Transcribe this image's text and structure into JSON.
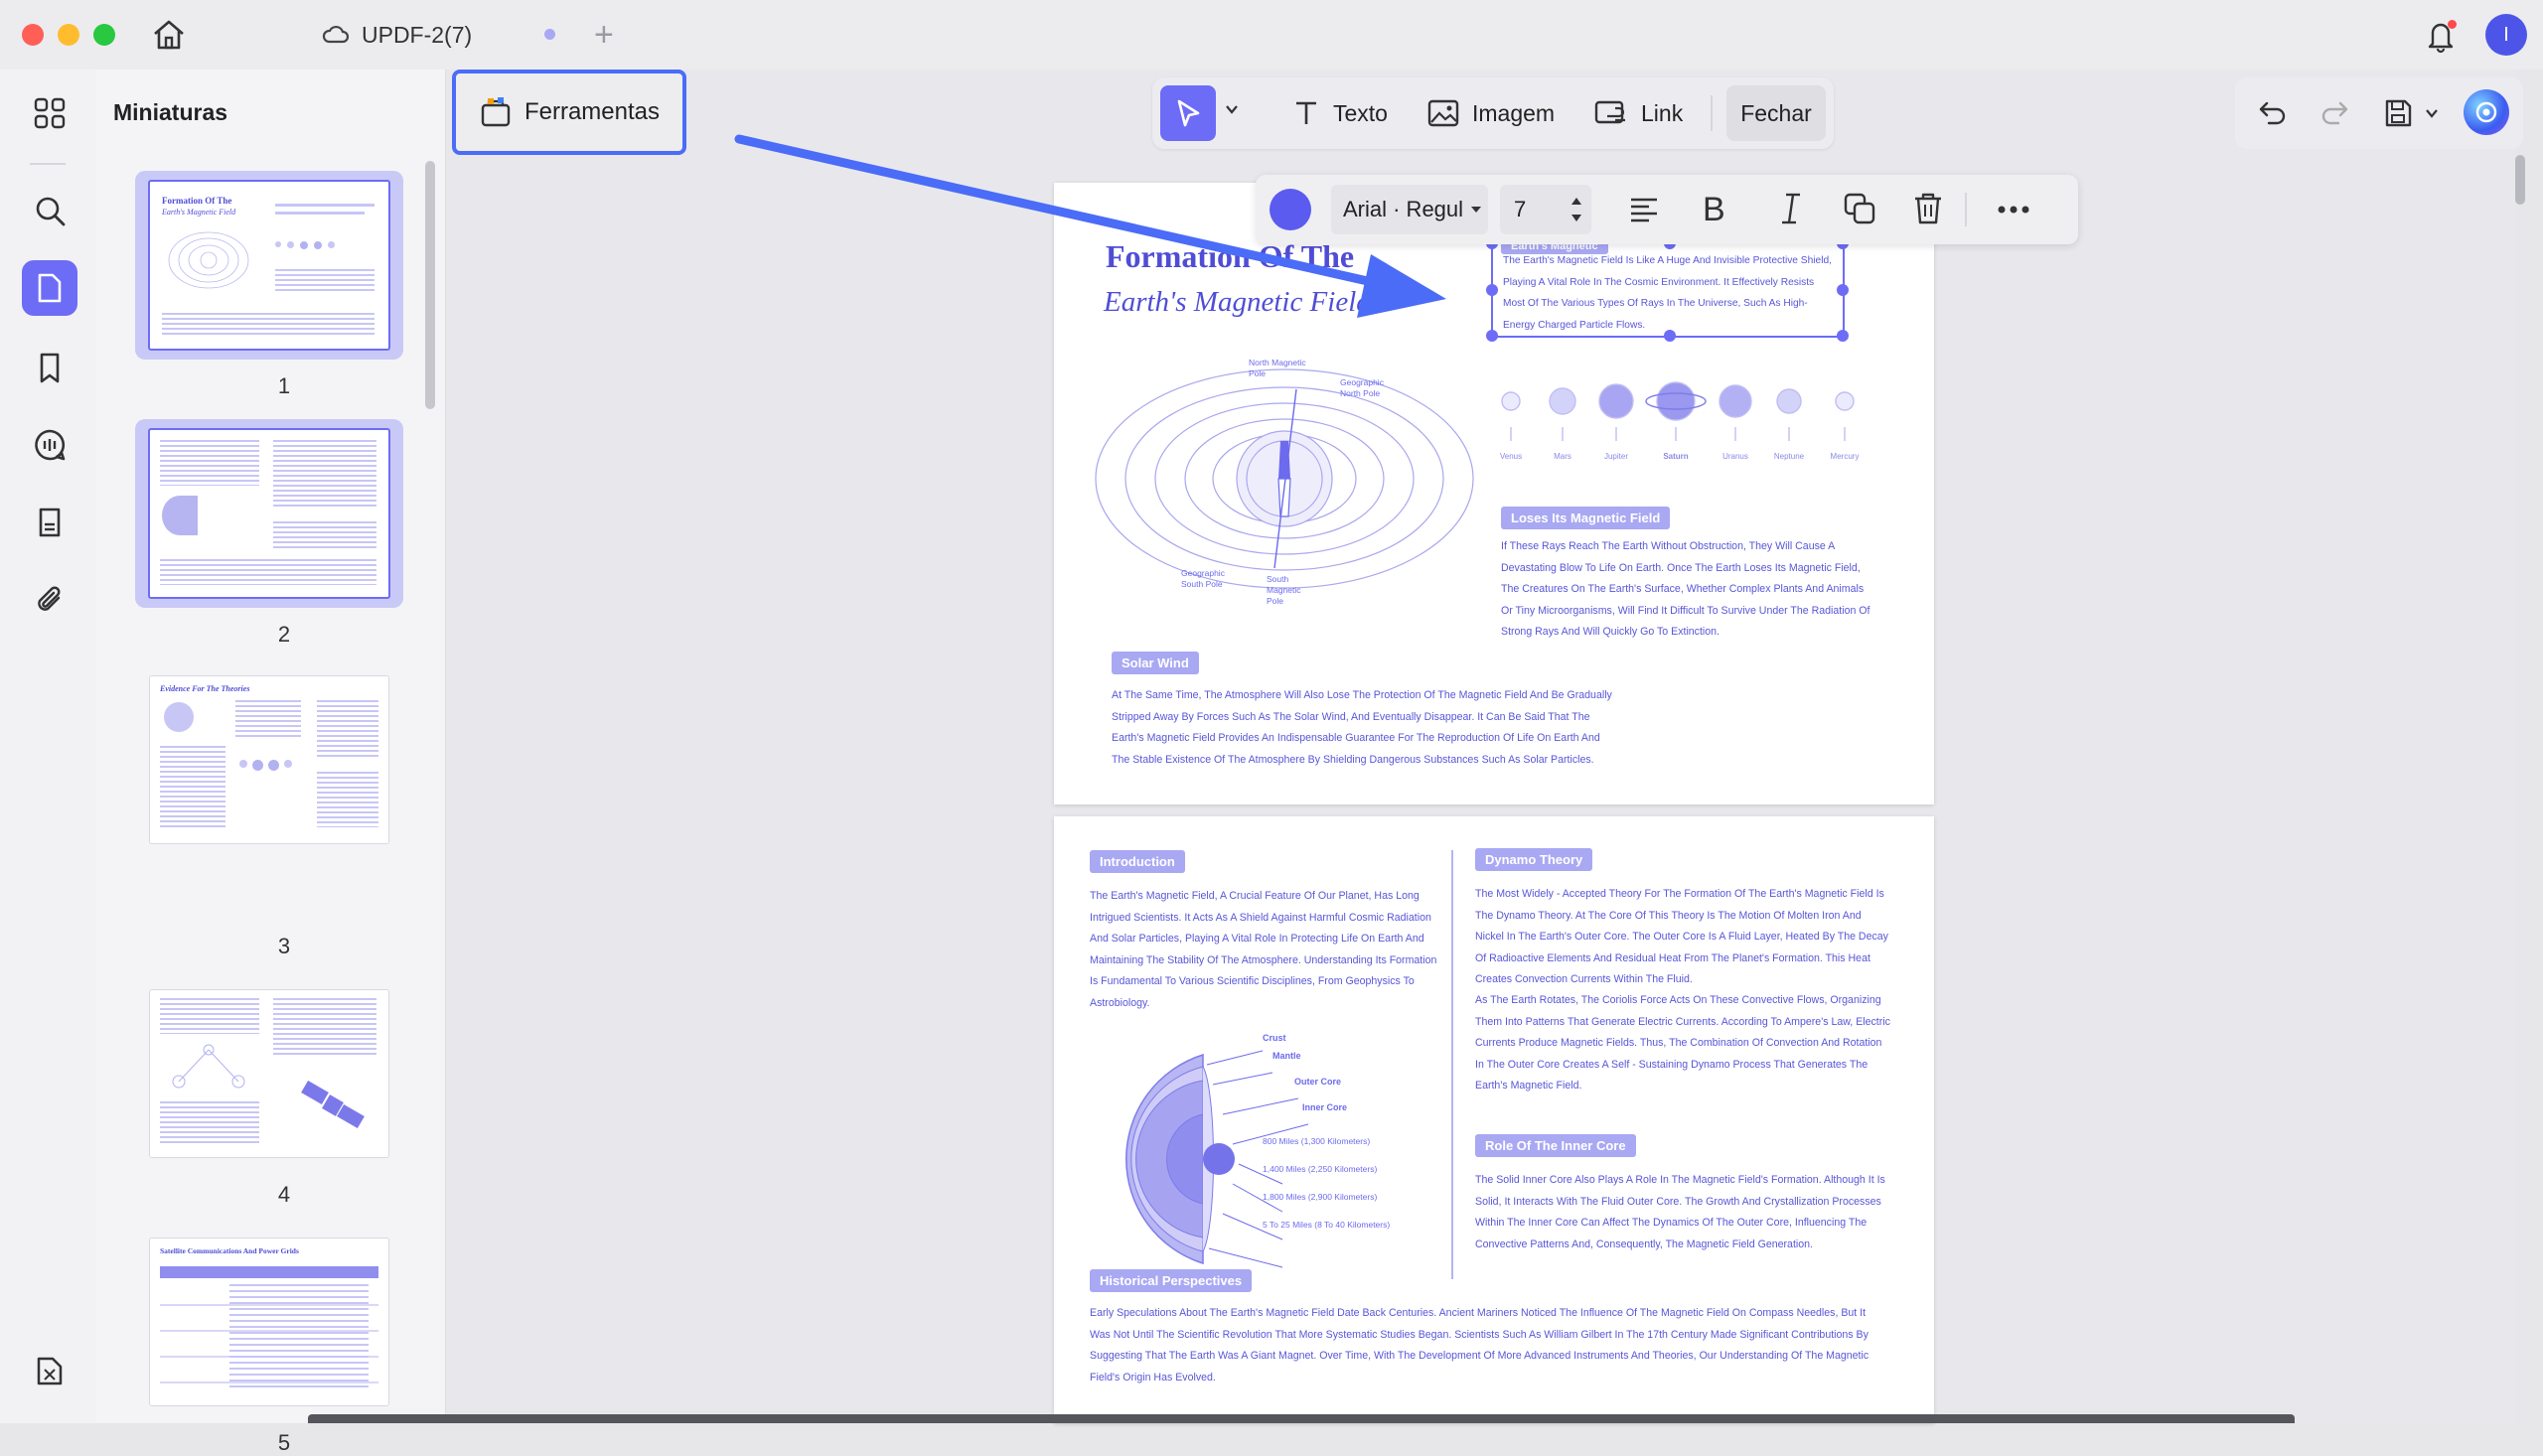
{
  "window": {
    "tab_title": "UPDF-2(7)",
    "user_initial": "I"
  },
  "sidebar": {
    "panel_title": "Miniaturas"
  },
  "thumbnails": [
    {
      "number": "1",
      "title": "Formation Of The",
      "subtitle": "Earth's Magnetic Field"
    },
    {
      "number": "2"
    },
    {
      "number": "3",
      "title": "Evidence For The Theories"
    },
    {
      "number": "4"
    },
    {
      "number": "5",
      "title": "Satellite Communications And Power Grids"
    }
  ],
  "toolbar": {
    "tools_label": "Ferramentas",
    "text_label": "Texto",
    "image_label": "Imagem",
    "link_label": "Link",
    "close_label": "Fechar"
  },
  "format_bar": {
    "color": "#5b5bf0",
    "font": "Arial · Regul",
    "size": "7"
  },
  "page1": {
    "title_line1": "Formation Of The",
    "title_line2": "Earth's Magnetic Field",
    "selected_heading": "Earth's Magnetic",
    "selected_text": "The Earth's Magnetic Field Is Like A Huge And Invisible Protective Shield, Playing A Vital Role In The Cosmic Environment. It Effectively Resists Most Of The Various Types Of Rays In The Universe, Such As High-Energy Charged Particle Flows.",
    "diagram_labels": {
      "north_magnetic": "North Magnetic Pole",
      "geographic_north": "Geographic North Pole",
      "geographic_south": "Geographic South Pole",
      "south_magnetic": "South Magnetic Pole"
    },
    "planets": [
      "Venus",
      "Mars",
      "Jupiter",
      "Saturn",
      "Uranus",
      "Neptune",
      "Mercury"
    ],
    "loses_heading": "Loses Its Magnetic Field",
    "loses_text": "If These Rays Reach The Earth Without Obstruction, They Will Cause A Devastating Blow To Life On Earth. Once The Earth Loses Its Magnetic Field, The Creatures On The Earth's Surface, Whether Complex Plants And Animals Or Tiny Microorganisms, Will Find It Difficult To Survive Under The Radiation Of Strong Rays And Will Quickly Go To Extinction.",
    "solar_heading": "Solar Wind",
    "solar_text": "At The Same Time, The Atmosphere Will Also Lose The Protection Of The Magnetic Field And Be Gradually Stripped Away By Forces Such As The Solar Wind, And Eventually Disappear. It Can Be Said That The Earth's Magnetic Field Provides An Indispensable Guarantee For The Reproduction Of Life On Earth And The Stable Existence Of The Atmosphere By Shielding Dangerous Substances Such As Solar Particles."
  },
  "page2": {
    "intro_heading": "Introduction",
    "intro_text": "The Earth's Magnetic Field, A Crucial Feature Of Our Planet, Has Long Intrigued Scientists. It Acts As A Shield Against Harmful Cosmic Radiation And Solar Particles, Playing A Vital Role In Protecting Life On Earth And Maintaining The Stability Of The Atmosphere. Understanding Its Formation Is Fundamental To Various Scientific Disciplines, From Geophysics To Astrobiology.",
    "dynamo_heading": "Dynamo Theory",
    "dynamo_text": "The Most Widely - Accepted Theory For The Formation Of The Earth's Magnetic Field Is The Dynamo Theory. At The Core Of This Theory Is The Motion Of Molten Iron And Nickel In The Earth's Outer Core. The Outer Core Is A Fluid Layer, Heated By The Decay Of Radioactive Elements And Residual Heat From The Planet's Formation. This Heat Creates Convection Currents Within The Fluid.",
    "dynamo_text2": "As The Earth Rotates, The Coriolis Force Acts On These Convective Flows, Organizing Them Into Patterns That Generate Electric Currents. According To Ampere's Law, Electric Currents Produce Magnetic Fields. Thus, The Combination Of Convection And Rotation In The Outer Core Creates A Self - Sustaining Dynamo Process That Generates The Earth's Magnetic Field.",
    "core_labels": {
      "crust": "Crust",
      "mantle": "Mantle",
      "outer_core": "Outer Core",
      "inner_core": "Inner Core",
      "d1": "800 Miles (1,300 Kilometers)",
      "d2": "1,400 Miles (2,250 Kilometers)",
      "d3": "1,800 Miles (2,900 Kilometers)",
      "d4": "5 To 25 Miles (8 To 40 Kilometers)"
    },
    "inner_heading": "Role Of The Inner Core",
    "inner_text": "The Solid Inner Core Also Plays A Role In The Magnetic Field's Formation. Although It Is Solid, It Interacts With The Fluid Outer Core. The Growth And Crystallization Processes Within The Inner Core Can Affect The Dynamics Of The Outer Core, Influencing The Convective Patterns And, Consequently, The Magnetic Field Generation.",
    "hist_heading": "Historical Perspectives",
    "hist_text": "Early Speculations About The Earth's Magnetic Field Date Back Centuries. Ancient Mariners Noticed The Influence Of The Magnetic Field On Compass Needles, But It Was Not Until The Scientific Revolution That More Systematic Studies Began. Scientists Such As William Gilbert In The 17th Century Made Significant Contributions By Suggesting That The Earth Was A Giant Magnet. Over Time, With The Development Of More Advanced Instruments And Theories, Our Understanding Of The Magnetic Field's Origin Has Evolved."
  }
}
